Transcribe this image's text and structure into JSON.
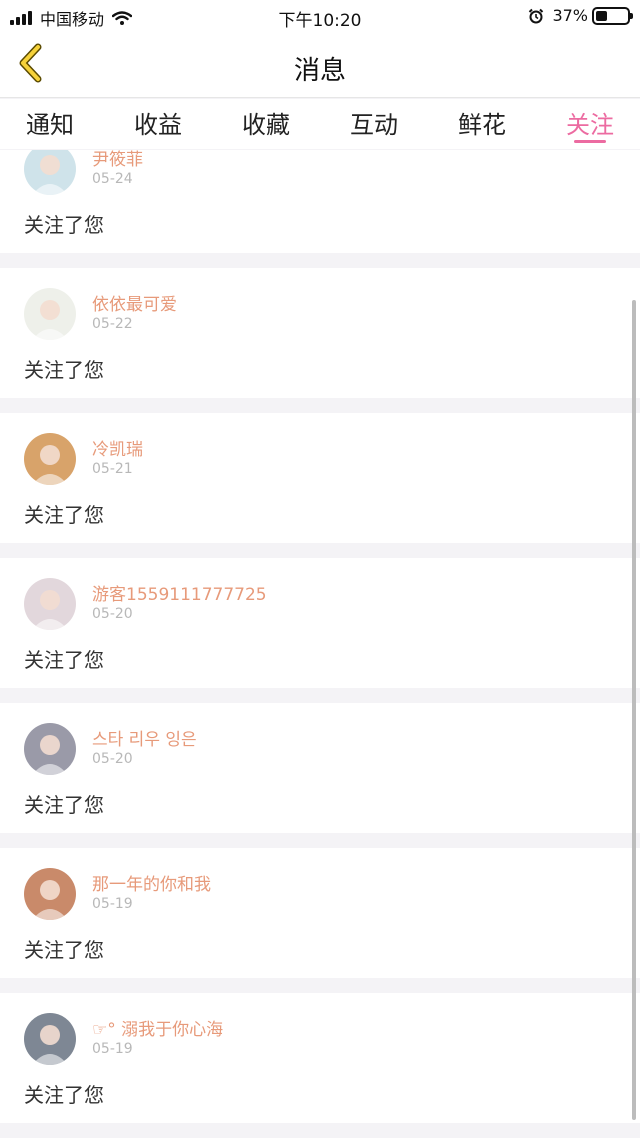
{
  "status_bar": {
    "carrier": "中国移动",
    "time": "下午10:20",
    "battery_percent": "37%",
    "battery_level": 0.37
  },
  "nav": {
    "back_icon": "chevron-left-icon",
    "title": "消息"
  },
  "tabs": [
    {
      "label": "通知",
      "active": false
    },
    {
      "label": "收益",
      "active": false
    },
    {
      "label": "收藏",
      "active": false
    },
    {
      "label": "互动",
      "active": false
    },
    {
      "label": "鲜花",
      "active": false
    },
    {
      "label": "关注",
      "active": true
    }
  ],
  "accent_color": "#ec6ba1",
  "name_color": "#e79a7a",
  "follows": [
    {
      "name": "尹筱菲",
      "date": "05-24",
      "text": "关注了您",
      "avatar_color": "#cfe3ea"
    },
    {
      "name": "依依最可爱",
      "date": "05-22",
      "text": "关注了您",
      "avatar_color": "#eef0ea"
    },
    {
      "name": "冷凯瑞",
      "date": "05-21",
      "text": "关注了您",
      "avatar_color": "#d8a36a"
    },
    {
      "name": "游客1559111777725",
      "date": "05-20",
      "text": "关注了您",
      "avatar_color": "#e2d7dc"
    },
    {
      "name": "스타 리우 잉은",
      "date": "05-20",
      "text": "关注了您",
      "avatar_color": "#9a9aa8"
    },
    {
      "name": "那一年的你和我",
      "date": "05-19",
      "text": "关注了您",
      "avatar_color": "#c98a6a"
    },
    {
      "name": "☞° 溺我于你心海",
      "date": "05-19",
      "text": "关注了您",
      "avatar_color": "#7e8794"
    }
  ]
}
